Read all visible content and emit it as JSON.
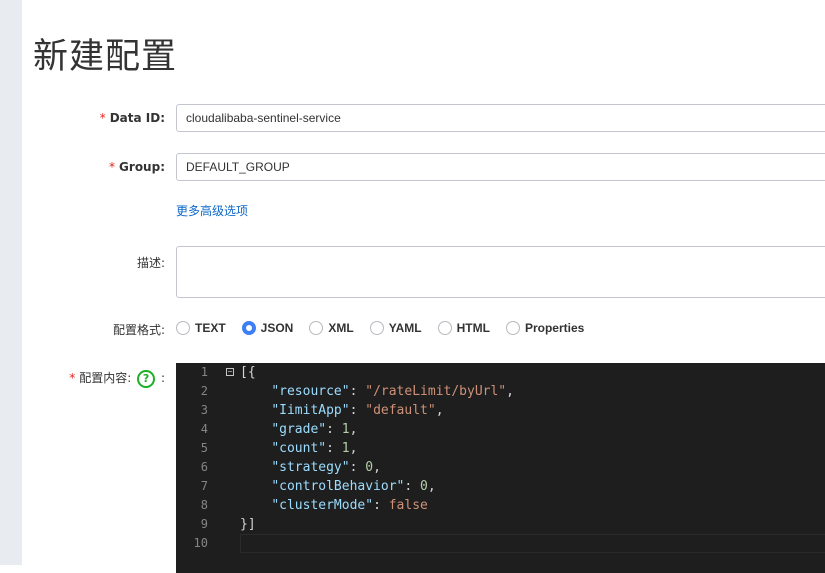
{
  "page": {
    "title": "新建配置"
  },
  "form": {
    "required_mark": "*",
    "data_id": {
      "label": "Data ID:",
      "value": "cloudalibaba-sentinel-service"
    },
    "group": {
      "label": "Group:",
      "value": "DEFAULT_GROUP"
    },
    "advanced_link": "更多高级选项",
    "description": {
      "label": "描述:",
      "value": ""
    },
    "format": {
      "label": "配置格式:",
      "options": [
        "TEXT",
        "JSON",
        "XML",
        "YAML",
        "HTML",
        "Properties"
      ],
      "selected": "JSON"
    },
    "content": {
      "label": "配置内容:",
      "help_icon": "question-circle-icon",
      "help_glyph": "?",
      "colon": ":"
    }
  },
  "editor": {
    "line_numbers": [
      "1",
      "2",
      "3",
      "4",
      "5",
      "6",
      "7",
      "8",
      "9",
      "10"
    ],
    "fold_glyph": "−",
    "lines": [
      [
        {
          "t": "[{",
          "c": "punc"
        }
      ],
      [
        {
          "t": "    ",
          "c": "punc"
        },
        {
          "t": "\"resource\"",
          "c": "key"
        },
        {
          "t": ": ",
          "c": "punc"
        },
        {
          "t": "\"/rateLimit/byUrl\"",
          "c": "str"
        },
        {
          "t": ",",
          "c": "punc"
        }
      ],
      [
        {
          "t": "    ",
          "c": "punc"
        },
        {
          "t": "\"IimitApp\"",
          "c": "key"
        },
        {
          "t": ": ",
          "c": "punc"
        },
        {
          "t": "\"default\"",
          "c": "str"
        },
        {
          "t": ",",
          "c": "punc"
        }
      ],
      [
        {
          "t": "    ",
          "c": "punc"
        },
        {
          "t": "\"grade\"",
          "c": "key"
        },
        {
          "t": ": ",
          "c": "punc"
        },
        {
          "t": "1",
          "c": "num"
        },
        {
          "t": ",",
          "c": "punc"
        }
      ],
      [
        {
          "t": "    ",
          "c": "punc"
        },
        {
          "t": "\"count\"",
          "c": "key"
        },
        {
          "t": ": ",
          "c": "punc"
        },
        {
          "t": "1",
          "c": "num"
        },
        {
          "t": ",",
          "c": "punc"
        }
      ],
      [
        {
          "t": "    ",
          "c": "punc"
        },
        {
          "t": "\"strategy\"",
          "c": "key"
        },
        {
          "t": ": ",
          "c": "punc"
        },
        {
          "t": "0",
          "c": "num"
        },
        {
          "t": ",",
          "c": "punc"
        }
      ],
      [
        {
          "t": "    ",
          "c": "punc"
        },
        {
          "t": "\"controlBehavior\"",
          "c": "key"
        },
        {
          "t": ": ",
          "c": "punc"
        },
        {
          "t": "0",
          "c": "num"
        },
        {
          "t": ",",
          "c": "punc"
        }
      ],
      [
        {
          "t": "    ",
          "c": "punc"
        },
        {
          "t": "\"clusterMode\"",
          "c": "key"
        },
        {
          "t": ": ",
          "c": "punc"
        },
        {
          "t": "false",
          "c": "kw"
        }
      ],
      [
        {
          "t": "}]",
          "c": "punc"
        }
      ],
      [
        {
          "t": "",
          "c": "punc"
        }
      ]
    ]
  },
  "colors": {
    "accent": "#3d7ff4",
    "required": "#e2231a",
    "link": "#0d68c8",
    "help": "#1bb026",
    "editor_bg": "#1e1e1e"
  }
}
